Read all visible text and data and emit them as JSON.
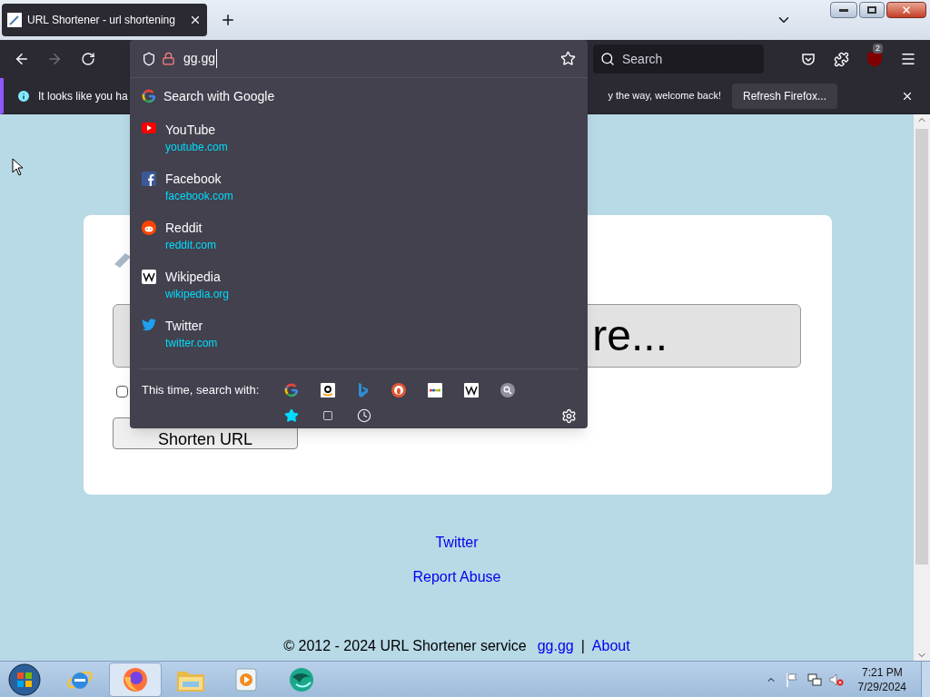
{
  "tabs": [
    {
      "title": "URL Shortener - url shortening",
      "selected": true
    }
  ],
  "address_bar": {
    "value": "gg.gg"
  },
  "search_field": {
    "placeholder": "Search"
  },
  "extension_badge": "2",
  "notification": {
    "text_left": "It looks like you ha",
    "text_right": "y the way, welcome back!",
    "button": "Refresh Firefox..."
  },
  "dropdown": {
    "search_row": "Search with Google",
    "suggestions": [
      {
        "kind": "youtube",
        "title": "YouTube",
        "url": "youtube.com"
      },
      {
        "kind": "facebook",
        "title": "Facebook",
        "url": "facebook.com"
      },
      {
        "kind": "reddit",
        "title": "Reddit",
        "url": "reddit.com"
      },
      {
        "kind": "wikipedia",
        "title": "Wikipedia",
        "url": "wikipedia.org"
      },
      {
        "kind": "twitter",
        "title": "Twitter",
        "url": "twitter.com"
      }
    ],
    "one_off_label": "This time, search with:",
    "engines": [
      {
        "kind": "google"
      },
      {
        "kind": "amazon"
      },
      {
        "kind": "bing"
      },
      {
        "kind": "duckduckgo"
      },
      {
        "kind": "ebay"
      },
      {
        "kind": "wikipedia"
      },
      {
        "kind": "search"
      }
    ],
    "modes": [
      {
        "kind": "bookmarks"
      },
      {
        "kind": "tabs"
      },
      {
        "kind": "history"
      }
    ]
  },
  "page": {
    "input_right": "re...",
    "checkbox": {
      "checked": false
    },
    "submit": "Shorten URL",
    "links": [
      "Twitter",
      "Report Abuse"
    ],
    "footer": {
      "copyright": "© 2012 - 2024 URL Shortener service",
      "site_link": "gg.gg",
      "separator": "|",
      "about_link": "About"
    }
  },
  "taskbar": {
    "apps": [
      {
        "kind": "ie",
        "selected": false
      },
      {
        "kind": "firefox",
        "selected": true
      },
      {
        "kind": "folder",
        "selected": false
      },
      {
        "kind": "media",
        "selected": false
      },
      {
        "kind": "globe",
        "selected": false
      }
    ],
    "time": "7:21 PM",
    "date": "7/29/2024"
  }
}
